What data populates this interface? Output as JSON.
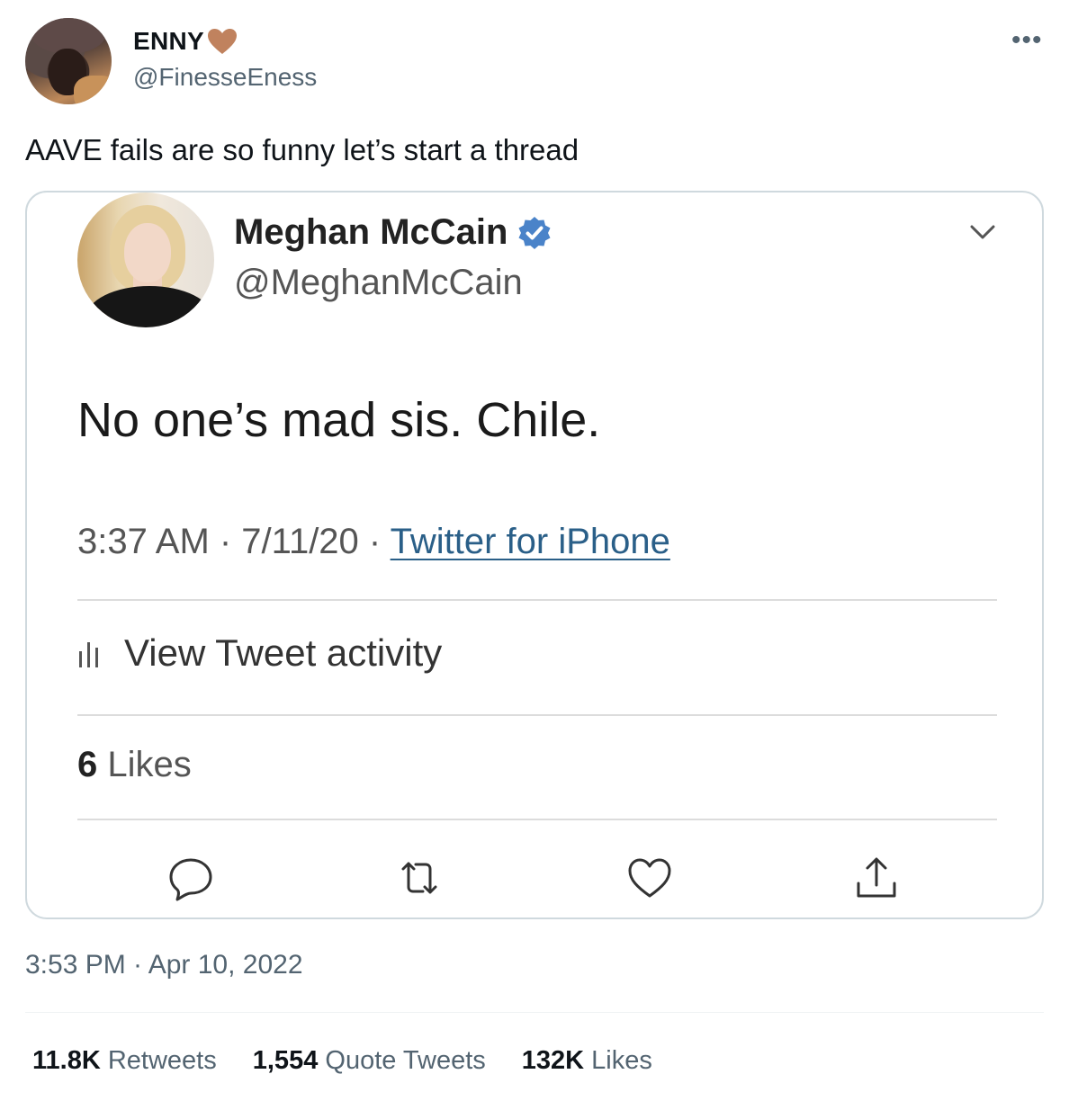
{
  "author": {
    "name": "ENNY",
    "handle": "@FinesseEness"
  },
  "tweet": {
    "text": "AAVE fails are so funny let’s start a thread",
    "timestamp": "3:53 PM · Apr 10, 2022"
  },
  "quoted": {
    "name": "Meghan McCain",
    "handle": "@MeghanMcCain",
    "text": "No one’s mad sis. Chile.",
    "time": "3:37 AM · 7/11/20 · ",
    "source": "Twitter for iPhone",
    "activity_label": "View Tweet activity",
    "likes_count": "6",
    "likes_label": " Likes"
  },
  "stats": {
    "retweets_count": "11.8K",
    "retweets_label": " Retweets",
    "quotes_count": "1,554",
    "quotes_label": " Quote Tweets",
    "likes_count": "132K",
    "likes_label": " Likes"
  },
  "icons": {
    "more": "more-icon",
    "heart_emoji": "heart-emoji-icon",
    "verified": "verified-badge-icon",
    "chevron": "chevron-down-icon",
    "activity": "bar-chart-icon",
    "reply": "reply-icon",
    "retweet": "retweet-icon",
    "like": "heart-icon",
    "share": "share-icon"
  },
  "colors": {
    "text_primary": "#0f1419",
    "text_secondary": "#536471",
    "verified_blue": "#4a83c9",
    "heart_emoji": "#c0825e",
    "link": "#2a5f88",
    "card_border": "#cfd9de"
  }
}
